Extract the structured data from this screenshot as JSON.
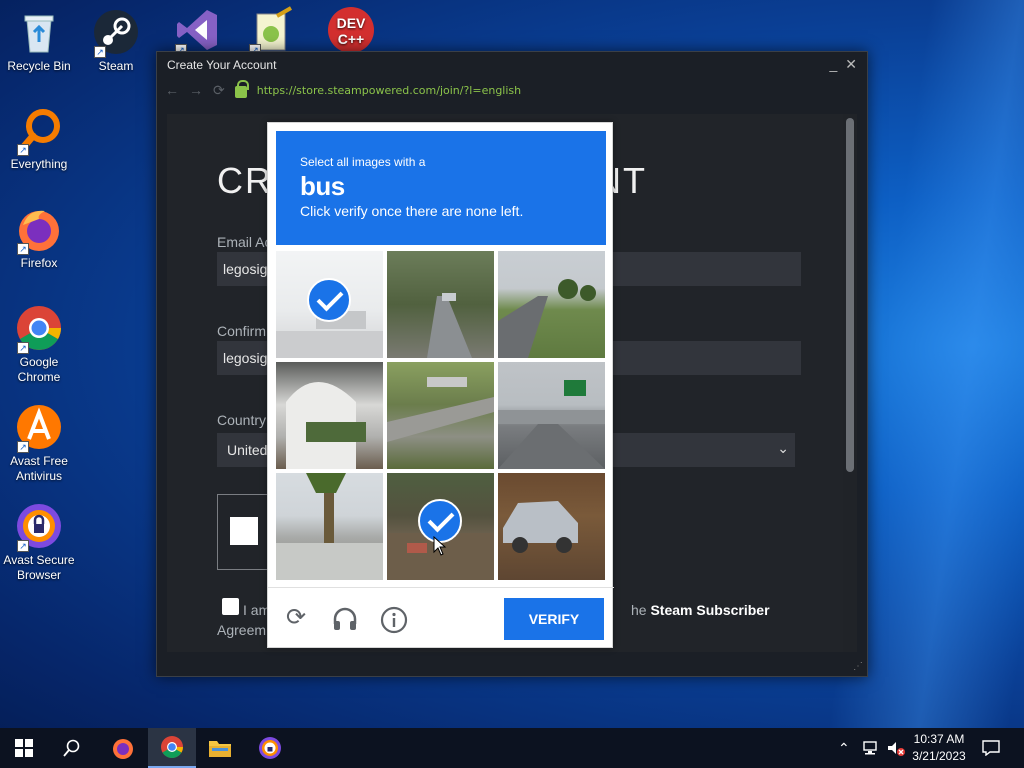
{
  "desktop": {
    "icons": [
      {
        "label": "Recycle Bin"
      },
      {
        "label": "Steam"
      },
      {
        "label": "Everything"
      },
      {
        "label": "Firefox"
      },
      {
        "label": "Google Chrome"
      },
      {
        "label": "Avast Free Antivirus"
      },
      {
        "label": "Avast Secure Browser"
      },
      {
        "label": "DEV C++"
      }
    ]
  },
  "window": {
    "title": "Create Your Account",
    "url": "https://store.steampowered.com/join/?l=english",
    "heading_left": "CRE",
    "heading_right": "NT",
    "fields": {
      "email_label": "Email Ac",
      "email_value": "legosig",
      "confirm_label": "Confirm",
      "confirm_value": "legosig",
      "country_label": "Country",
      "country_value": "United"
    },
    "agree_start": "I am",
    "agree_mid": "he ",
    "agree_link": "Steam Subscriber",
    "agree_end": "Agreem"
  },
  "captcha": {
    "line1": "Select all images with a",
    "target": "bus",
    "line3": "Click verify once there are none left.",
    "verify_label": "VERIFY",
    "selected_tiles": [
      0,
      7
    ]
  },
  "taskbar": {
    "time": "10:37 AM",
    "date": "3/21/2023"
  },
  "colors": {
    "accent": "#1a73e8",
    "steam_bg": "#1b1f26",
    "url_green": "#8bc34a"
  }
}
